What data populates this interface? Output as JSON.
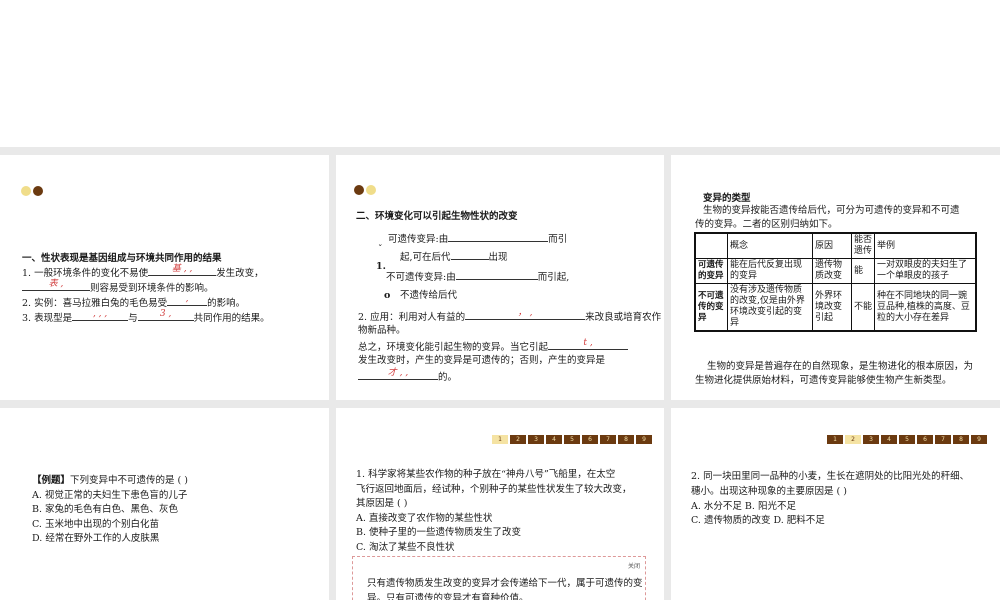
{
  "slide1": {
    "heading": "一、性状表现是基因组成与环境共同作用的结果",
    "l1_pre": "1. 一般环境条件的变化不易使",
    "l1_ans": "基 , ,",
    "l1_post": "发生改变，",
    "l2_ans": "表 ,",
    "l2_post": "则容易受到环境条件的影响。",
    "l3_pre": "2. 实例：喜马拉雅白兔的毛色易受",
    "l3_ans": ",",
    "l3_post": "的影响。",
    "l4_pre": "3. 表现型是",
    "l4_ans1": ", , ,",
    "l4_mid": "与",
    "l4_ans2": "3 ,",
    "l4_post": "共同作用的结果。"
  },
  "slide2": {
    "heading": "二、环境变化可以引起生物性状的改变",
    "r1_pre": "可遗传变异:由",
    "r1_post": "而引",
    "r2_pre": "起,可在后代",
    "r2_post": "出现",
    "num": "1.",
    "r3_pre": "不可遗传变异:由",
    "r3_post": "而引起,",
    "r4": "不遗传给后代",
    "bullet": "o",
    "a1_pre": "2. 应用：利用对人有益的",
    "a1_ans": "，  ,",
    "a1_post": "来改良或培育农作",
    "a2": "物新品种。",
    "s1_pre": "总之，环境变化能引起生物的变异。当它引起",
    "s1_ans": "t ,",
    "s2": "发生改变时，产生的变异是可遗传的；否则，产生的变异是",
    "s3_ans": "才 , ,",
    "s3_post": "的。"
  },
  "slide3": {
    "heading": "变异的类型",
    "intro1": "生物的变异按能否遗传给后代，可分为可遗传的变异和不可遗",
    "intro2": "传的变异。二者的区别归纳如下。",
    "table": {
      "headers": [
        "",
        "概念",
        "原因",
        "能否遗传",
        "举例"
      ],
      "rows": [
        [
          "可遗传的变异",
          "能在后代反复出现的变异",
          "遗传物质改变",
          "能",
          "一对双眼皮的夫妇生了一个单眼皮的孩子"
        ],
        [
          "不可遗传的变异",
          "没有涉及遗传物质的改变,仅是由外界环境改变引起的变异",
          "外界环境改变引起",
          "不能",
          "种在不同地块的同一豌豆品种,植株的高度、豆粒的大小存在差异"
        ]
      ]
    },
    "outro1": "生物的变异是普遍存在的自然现象，是生物进化的根本原因，为",
    "outro2": "生物进化提供原始材料，可遗传变异能够使生物产生新类型。"
  },
  "slide4": {
    "q_label": "【例题】",
    "q_text": "下列变异中不可遗传的是 (        )",
    "options": [
      "A. 视觉正常的夫妇生下患色盲的儿子",
      "B. 家兔的毛色有白色、黑色、灰色",
      "C. 玉米地中出现的个别白化苗",
      "D. 经常在野外工作的人皮肤黑"
    ]
  },
  "slide5": {
    "pages": [
      "1",
      "2",
      "3",
      "4",
      "5",
      "6",
      "7",
      "8",
      "9"
    ],
    "q1": "1. 科学家将某些农作物的种子放在“神舟八号”飞船里，在太空",
    "q2": "飞行返回地面后，经试种，个别种子的某些性状发生了较大改变，",
    "q3": "其原因是 (   )",
    "options": [
      "A. 直接改变了农作物的某些性状",
      "B. 使种子里的一些遗传物质发生了改变",
      "C. 淘汰了某些不良性状"
    ],
    "close": "关闭",
    "expl1": "只有遗传物质发生改变的变异才会传递给下一代，属于可遗传的变",
    "expl2": "异。只有可遗传的变异才有育种价值。"
  },
  "slide6": {
    "pages": [
      "1",
      "2",
      "3",
      "4",
      "5",
      "6",
      "7",
      "8",
      "9"
    ],
    "q1": "2. 同一块田里同一品种的小麦，生长在遮阴处的比阳光处的秆细、",
    "q2": "穗小。出现这种现象的主要原因是 (   )",
    "opt1": "A. 水分不足     B. 阳光不足",
    "opt2": "C. 遗传物质的改变    D. 肥料不足"
  }
}
